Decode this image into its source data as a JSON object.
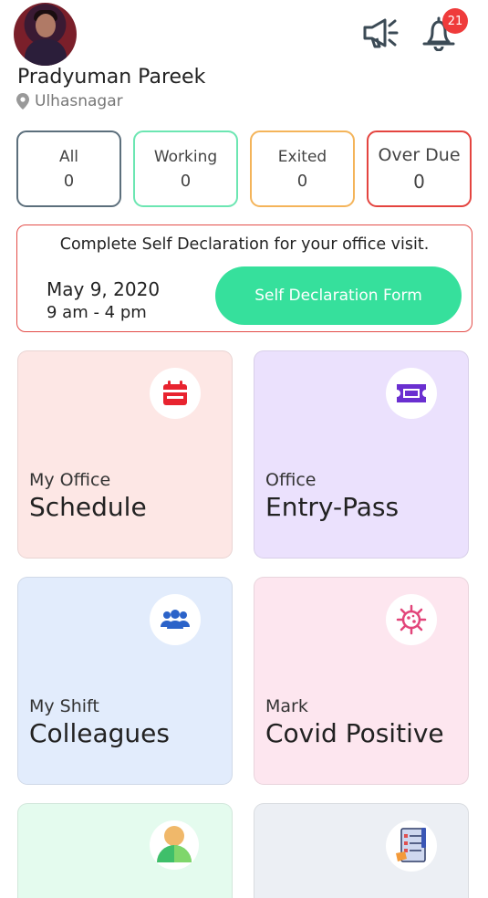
{
  "header": {
    "avatar_icon": "profile-photo",
    "user_name": "Pradyuman Pareek",
    "location": "Ulhasnagar",
    "notification_count": "21",
    "icons": [
      "location-pin-icon",
      "megaphone-icon",
      "bell-icon"
    ]
  },
  "stats": [
    {
      "label": "All",
      "value": "0",
      "color": "#5c6f7c"
    },
    {
      "label": "Working",
      "value": "0",
      "color": "#6ce6b2"
    },
    {
      "label": "Exited",
      "value": "0",
      "color": "#f4b45a"
    },
    {
      "label": "Over Due",
      "value": "0",
      "color": "#e4443f"
    }
  ],
  "declaration": {
    "message": "Complete Self Declaration for your office visit.",
    "date": "May 9, 2020",
    "time": "9 am - 4 pm",
    "button_label": "Self Declaration Form",
    "button_color": "#36e09c",
    "border_color": "#e34c48"
  },
  "cards": [
    {
      "pre": "My Office",
      "title": "Schedule",
      "icon": "calendar-icon",
      "bg": "#fde7e5"
    },
    {
      "pre": "Office",
      "title": "Entry-Pass",
      "icon": "ticket-icon",
      "bg": "#ebe1fd"
    },
    {
      "pre": "My Shift",
      "title": "Colleagues",
      "icon": "group-icon",
      "bg": "#e2ecfc"
    },
    {
      "pre": "Mark",
      "title": "Covid Positive",
      "icon": "virus-icon",
      "bg": "#fde6ef"
    },
    {
      "pre": "",
      "title": "",
      "icon": "person-icon",
      "bg": "#e4fbee"
    },
    {
      "pre": "",
      "title": "",
      "icon": "checklist-icon",
      "bg": "#eceff4"
    }
  ]
}
